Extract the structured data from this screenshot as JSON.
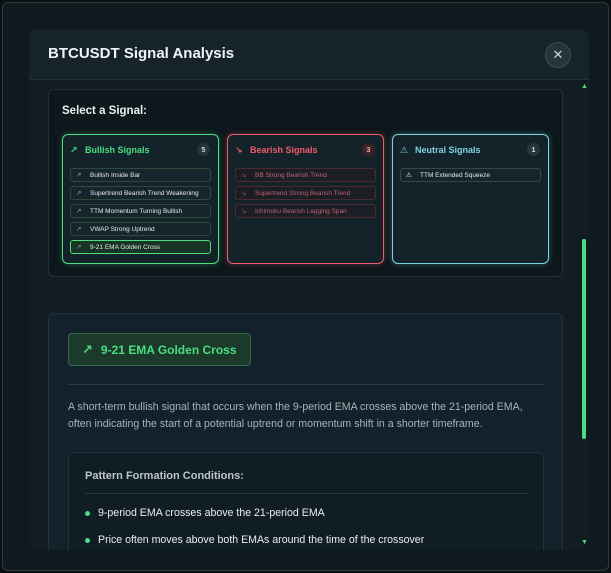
{
  "modal": {
    "title": "BTCUSDT Signal Analysis",
    "close_label": "✕"
  },
  "selector": {
    "title": "Select a Signal:",
    "groups": [
      {
        "label": "Bullish Signals",
        "count": "5",
        "icon": "trending-up-icon",
        "items": [
          "Bullish Inside Bar",
          "Supertrend Bearish Trend Weakening",
          "TTM Momentum Turning Bullish",
          "VWAP Strong Uptrend",
          "9-21 EMA Golden Cross"
        ],
        "selected": "9-21 EMA Golden Cross"
      },
      {
        "label": "Bearish Signals",
        "count": "3",
        "icon": "trending-down-icon",
        "items": [
          "BB Strong Bearish Trend",
          "Supertrend Strong Bearish Trend",
          "Ichimoku Bearish Lagging Span"
        ]
      },
      {
        "label": "Neutral Signals",
        "count": "1",
        "icon": "warning-icon",
        "items": [
          "TTM Extended Squeeze"
        ]
      }
    ]
  },
  "detail": {
    "signal_name": "9-21 EMA Golden Cross",
    "description": "A short-term bullish signal that occurs when the 9-period EMA crosses above the 21-period EMA, often indicating the start of a potential uptrend or momentum shift in a shorter timeframe.",
    "conditions_title": "Pattern Formation Conditions:",
    "conditions": [
      "9-period EMA crosses above the 21-period EMA",
      "Price often moves above both EMAs around the time of the crossover"
    ]
  },
  "colors": {
    "bullish": "#4ade80",
    "bearish": "#f05b6c",
    "neutral": "#7dd3e0"
  }
}
